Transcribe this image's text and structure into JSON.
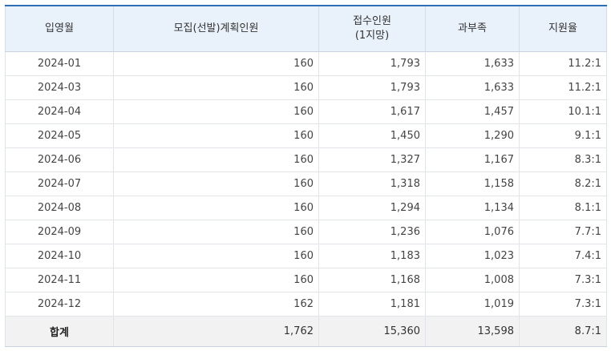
{
  "headers": [
    "입영월",
    "모집(선발)계획인원",
    "접수인원",
    "(1지망)",
    "과부족",
    "지원율"
  ],
  "rows": [
    {
      "month": "2024-01",
      "plan": "160",
      "applicants": "1,793",
      "diff": "1,633",
      "rate": "11.2:1"
    },
    {
      "month": "2024-03",
      "plan": "160",
      "applicants": "1,793",
      "diff": "1,633",
      "rate": "11.2:1"
    },
    {
      "month": "2024-04",
      "plan": "160",
      "applicants": "1,617",
      "diff": "1,457",
      "rate": "10.1:1"
    },
    {
      "month": "2024-05",
      "plan": "160",
      "applicants": "1,450",
      "diff": "1,290",
      "rate": "9.1:1"
    },
    {
      "month": "2024-06",
      "plan": "160",
      "applicants": "1,327",
      "diff": "1,167",
      "rate": "8.3:1"
    },
    {
      "month": "2024-07",
      "plan": "160",
      "applicants": "1,318",
      "diff": "1,158",
      "rate": "8.2:1"
    },
    {
      "month": "2024-08",
      "plan": "160",
      "applicants": "1,294",
      "diff": "1,134",
      "rate": "8.1:1"
    },
    {
      "month": "2024-09",
      "plan": "160",
      "applicants": "1,236",
      "diff": "1,076",
      "rate": "7.7:1"
    },
    {
      "month": "2024-10",
      "plan": "160",
      "applicants": "1,183",
      "diff": "1,023",
      "rate": "7.4:1"
    },
    {
      "month": "2024-11",
      "plan": "160",
      "applicants": "1,168",
      "diff": "1,008",
      "rate": "7.3:1"
    },
    {
      "month": "2024-12",
      "plan": "162",
      "applicants": "1,181",
      "diff": "1,019",
      "rate": "7.3:1"
    }
  ],
  "total": {
    "label": "합계",
    "plan": "1,762",
    "applicants": "15,360",
    "diff": "13,598",
    "rate": "8.7:1"
  }
}
